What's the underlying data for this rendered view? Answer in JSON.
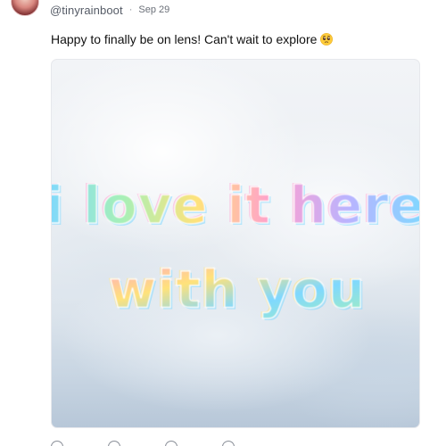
{
  "post": {
    "handle": "@tinyrainboot",
    "separator": "·",
    "date": "Sep 29",
    "caption": "Happy to finally be on lens! Can't wait to explore",
    "caption_emoji": "pleading-face",
    "media": {
      "line1": "i love it here",
      "line2": "with you",
      "style": "holographic rainbow text over soft white clouds"
    }
  },
  "actions": [
    {
      "name": "comment-icon"
    },
    {
      "name": "mirror-icon"
    },
    {
      "name": "collect-icon"
    },
    {
      "name": "like-icon"
    }
  ],
  "colors": {
    "handle": "#555b66",
    "caption": "#111111",
    "holo_cyan": "#7fd8ff",
    "holo_pink": "#ff9ed0",
    "holo_yellow": "#ffe27a",
    "holo_green": "#a6f0b8"
  }
}
